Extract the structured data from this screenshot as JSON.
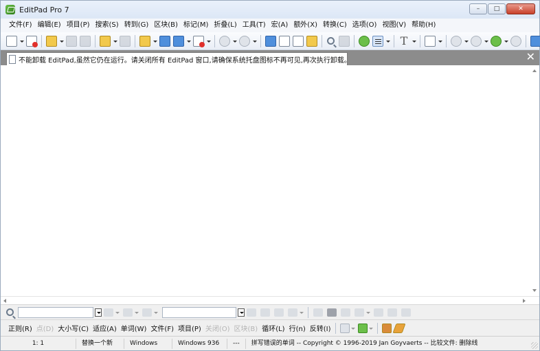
{
  "window": {
    "title": "EditPad Pro 7",
    "controls": {
      "minimize": "–",
      "maximize": "□",
      "close": "✕"
    }
  },
  "menu": [
    "文件(F)",
    "编辑(E)",
    "项目(P)",
    "搜索(S)",
    "转到(G)",
    "区块(B)",
    "标记(M)",
    "折叠(L)",
    "工具(T)",
    "宏(A)",
    "额外(X)",
    "转换(C)",
    "选项(O)",
    "视图(V)",
    "帮助(H)"
  ],
  "tab": {
    "label": "不能卸载 EditPad,虽然它仍在运行。请关闭所有 EditPad 窗口,请确保系统托盘图标不再可见,再次执行卸载。 1",
    "close": "✕"
  },
  "options_bar": {
    "items": [
      {
        "label": "正则(R)",
        "enabled": true
      },
      {
        "label": "点(D)",
        "enabled": false
      },
      {
        "label": "大小写(C)",
        "enabled": true
      },
      {
        "label": "适应(A)",
        "enabled": true
      },
      {
        "label": "单词(W)",
        "enabled": true
      },
      {
        "label": "文件(F)",
        "enabled": true
      },
      {
        "label": "项目(P)",
        "enabled": true
      },
      {
        "label": "关闭(O)",
        "enabled": false
      },
      {
        "label": "区块(B)",
        "enabled": false
      },
      {
        "label": "循环(L)",
        "enabled": true
      },
      {
        "label": "行(n)",
        "enabled": true
      },
      {
        "label": "反转(I)",
        "enabled": true
      }
    ]
  },
  "status": {
    "position": "1: 1",
    "mode": "替换一个新",
    "line_ending": "Windows",
    "encoding": "Windows 936",
    "separator": "---",
    "message": "拼写错误的单词 -- Copyright © 1996-2019 Jan Goyvaerts -- 比较文件: 删除线"
  },
  "colors": {
    "titlebar": "#dce7f6",
    "tabbar": "#8c8c8c",
    "close_button": "#c8412a"
  }
}
